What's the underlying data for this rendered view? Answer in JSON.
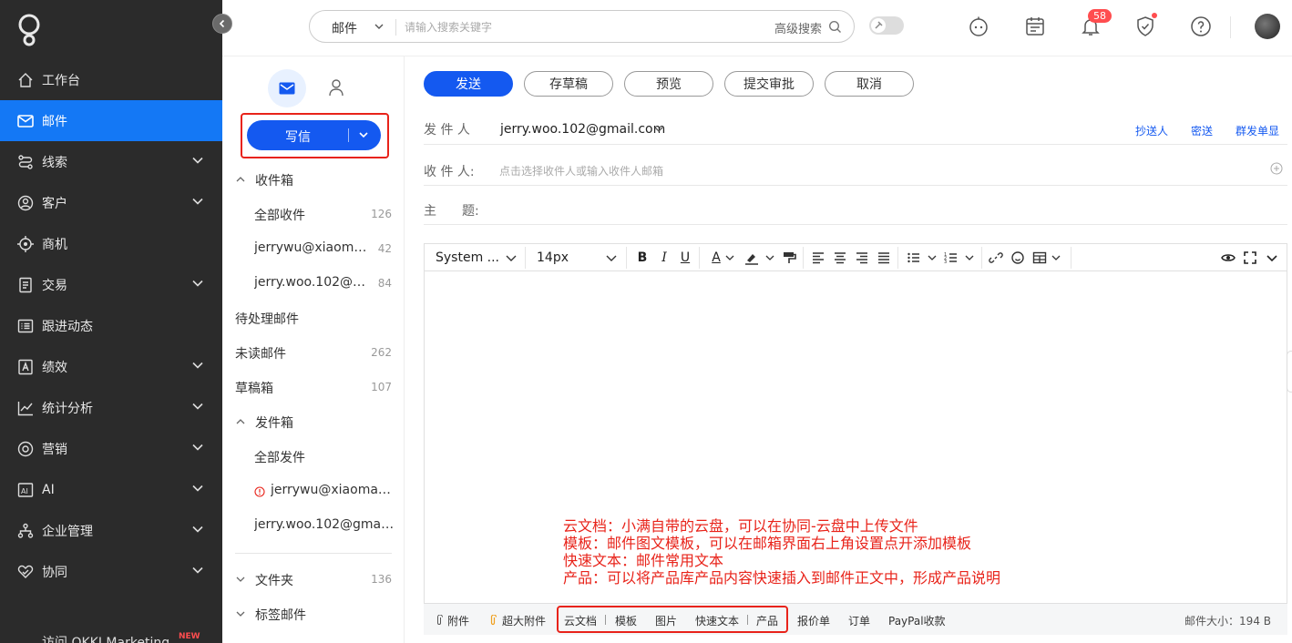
{
  "sidebar": {
    "items": [
      {
        "label": "工作台",
        "icon": "home-icon",
        "chevron": false
      },
      {
        "label": "邮件",
        "icon": "mail-icon",
        "chevron": false,
        "active": true
      },
      {
        "label": "线索",
        "icon": "route-icon",
        "chevron": true
      },
      {
        "label": "客户",
        "icon": "customer-icon",
        "chevron": true
      },
      {
        "label": "商机",
        "icon": "target-icon",
        "chevron": false
      },
      {
        "label": "交易",
        "icon": "document-icon",
        "chevron": true
      },
      {
        "label": "跟进动态",
        "icon": "list-icon",
        "chevron": false
      },
      {
        "label": "绩效",
        "icon": "performance-icon",
        "chevron": true
      },
      {
        "label": "统计分析",
        "icon": "chart-icon",
        "chevron": true
      },
      {
        "label": "营销",
        "icon": "marketing-icon",
        "chevron": true
      },
      {
        "label": "AI",
        "icon": "ai-icon",
        "chevron": true
      },
      {
        "label": "企业管理",
        "icon": "org-icon",
        "chevron": true
      },
      {
        "label": "协同",
        "icon": "collab-icon",
        "chevron": true
      }
    ],
    "footer_label": "访问 OKKI Marketing",
    "footer_badge": "NEW"
  },
  "topbar": {
    "search_type": "邮件",
    "search_placeholder": "请输入搜索关键字",
    "advanced_search": "高级搜索",
    "notification_count": "58"
  },
  "folders": {
    "compose_label": "写信",
    "items": [
      {
        "label": "收件箱",
        "count": "",
        "level": 0,
        "chevron": "up"
      },
      {
        "label": "全部收件",
        "count": "126",
        "level": 1
      },
      {
        "label": "jerrywu@xiaoman...",
        "count": "42",
        "level": 1
      },
      {
        "label": "jerry.woo.102@g...",
        "count": "84",
        "level": 1
      },
      {
        "label": "待处理邮件",
        "count": "",
        "level": 0
      },
      {
        "label": "未读邮件",
        "count": "262",
        "level": 0
      },
      {
        "label": "草稿箱",
        "count": "107",
        "level": 0
      },
      {
        "label": "发件箱",
        "count": "",
        "level": 0,
        "chevron": "up"
      },
      {
        "label": "全部发件",
        "count": "",
        "level": 1
      },
      {
        "label": "jerrywu@xiaoman....",
        "count": "",
        "level": 1,
        "warning": true
      },
      {
        "label": "jerry.woo.102@gmail....",
        "count": "",
        "level": 1
      },
      {
        "label": "文件夹",
        "count": "136",
        "level": 0,
        "chevron": "down"
      },
      {
        "label": "标签邮件",
        "count": "",
        "level": 0,
        "chevron": "down"
      }
    ]
  },
  "compose": {
    "actions": [
      "发送",
      "存草稿",
      "预览",
      "提交审批",
      "取消"
    ],
    "from_label": "发 件 人",
    "from_value": "jerry.woo.102@gmail.com",
    "cc_links": [
      "抄送人",
      "密送",
      "群发单显"
    ],
    "to_label": "收 件 人:",
    "to_placeholder": "点击选择收件人或输入收件人邮箱",
    "subject_label": "主　　题:",
    "editor": {
      "font_family": "System ...",
      "font_size": "14px"
    },
    "annotation_lines": [
      "云文档：小满自带的云盘，可以在协同-云盘中上传文件",
      "模板：邮件图文模板，可以在邮箱界面右上角设置点开添加模板",
      "快速文本：邮件常用文本",
      "产品：可以将产品库产品内容快速插入到邮件正文中，形成产品说明"
    ],
    "attachments": {
      "attach": "附件",
      "large_attach": "超大附件",
      "cloud_doc": "云文档",
      "template": "模板",
      "image": "图片",
      "quick_text": "快速文本",
      "product": "产品",
      "quote": "报价单",
      "order": "订单",
      "paypal": "PayPal收款",
      "mail_size": "邮件大小：194 B"
    }
  },
  "colors": {
    "sidebar_bg": "#2b2b2b",
    "primary": "#1459f0",
    "active_nav": "#1478f5",
    "highlight_red": "#e8231a"
  }
}
